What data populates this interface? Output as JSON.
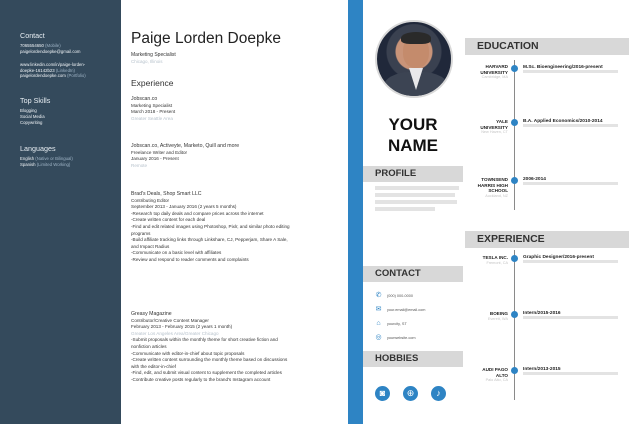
{
  "left": {
    "sidebar": {
      "contact_heading": "Contact",
      "phone": "7065554650",
      "phone_note": "(Mobile)",
      "email": "paigelordendoepke@gmail.com",
      "linkedin_1": "www.linkedin.com/in/paige-lorden-",
      "linkedin_2": "doepke-16142b23",
      "linkedin_note": "(LinkedIn)",
      "portfolio": "paigelordendoepke.com",
      "portfolio_note": "(Portfolio)",
      "skills_heading": "Top Skills",
      "skills": [
        "Blogging",
        "Social Media",
        "Copywriting"
      ],
      "languages_heading": "Languages",
      "lang_1": "English",
      "lang_1_note": "(Native or Bilingual)",
      "lang_2": "Spanish",
      "lang_2_note": "(Limited Working)"
    },
    "name": "Paige Lorden Doepke",
    "role": "Marketing Specialist",
    "location": "Chicago, Illinois",
    "experience_heading": "Experience",
    "jobs": [
      {
        "company": "Jobscan.co",
        "title": "Marketing Specialist",
        "dates": "March 2018 - Present",
        "location": "Greater Seattle Area",
        "bullets": []
      },
      {
        "company": "Jobscan.co, Activeyte, Marketo, Quill and more",
        "title": "Freelance Writer and Editor",
        "dates": "January 2016 - Present",
        "location": "Remote",
        "bullets": []
      },
      {
        "company": "Brad's Deals, Shop Smart LLC",
        "title": "Contributing Editor",
        "dates": "September 2013 - January 2016 (2 years 5 months)",
        "location": "",
        "bullets": [
          "-Research top daily deals and compare prices across the internet",
          "-Create written content for each deal",
          "-Find and edit related images using Photoshop, Pixlr, and similar photo editing",
          "programs",
          "-Build affiliate tracking links through Linkshare, CJ, Pepperjam, Share A Sale,",
          "and Impact Radius",
          "-Communicate on a basic level with affiliates",
          "-Review and respond to reader comments and complaints"
        ]
      },
      {
        "company": "Greasy Magazine",
        "title": "Contributor/Creative Content Manager",
        "dates": "February 2013 - February 2015 (2 years 1 month)",
        "location": "Greater Los Angeles Area/Greater Chicago",
        "bullets": [
          "-Submit proposals within the monthly theme for short creative fiction and",
          "nonfiction articles",
          "-Communicate with editor-in-chief about topic proposals",
          "-Create written content surrounding the monthly theme based on discussions",
          "with the editor-in-chief",
          "-Find, edit, and submit visual content to supplement the completed articles",
          "-Contribute creative posts regularly to the brand's Instagram account"
        ]
      }
    ]
  },
  "right": {
    "name_line1": "YOUR",
    "name_line2": "NAME",
    "profile_label": "PROFILE",
    "contact_label": "CONTACT",
    "hobbies_label": "HOBBIES",
    "contacts": [
      {
        "icon": "phone-icon",
        "glyph": "✆",
        "text": "(000) 000-0000"
      },
      {
        "icon": "email-icon",
        "glyph": "✉",
        "text": "your.email@email.com"
      },
      {
        "icon": "home-icon",
        "glyph": "⌂",
        "text": "yourcity, ST"
      },
      {
        "icon": "web-icon",
        "glyph": "◎",
        "text": "yourwebsite.com"
      }
    ],
    "hobbies": [
      {
        "icon": "camera-icon",
        "glyph": "◙"
      },
      {
        "icon": "basketball-icon",
        "glyph": "⊕"
      },
      {
        "icon": "guitar-icon",
        "glyph": "♪"
      }
    ],
    "education_heading": "EDUCATION",
    "education": [
      {
        "school_1": "HARVARD",
        "school_2": "UNIVERSITY",
        "sub": "Cambridge, MA",
        "degree": "M.Sc. Bioengineering/2016-present"
      },
      {
        "school_1": "YALE",
        "school_2": "UNIVERSITY",
        "sub": "New Haven, CT",
        "degree": "B.A. Applied Economics/2010-2014"
      },
      {
        "school_1": "TOWNSEND",
        "school_2": "HARRIS HIGH",
        "school_3": "SCHOOL",
        "sub": "Auckland, NZ",
        "degree": "2006-2014"
      }
    ],
    "experience_heading": "EXPERIENCE",
    "experience": [
      {
        "org_1": "TESLA INC.",
        "sub": "Fremont, CA",
        "role": "Graphic Designer/2016-present"
      },
      {
        "org_1": "BOEING",
        "sub": "Everett, WA",
        "role": "Intern/2015-2016"
      },
      {
        "org_1": "AUDI PAGO",
        "org_2": "ALTO",
        "sub": "Palo Alto, CA",
        "role": "Intern/2013-2015"
      }
    ]
  }
}
